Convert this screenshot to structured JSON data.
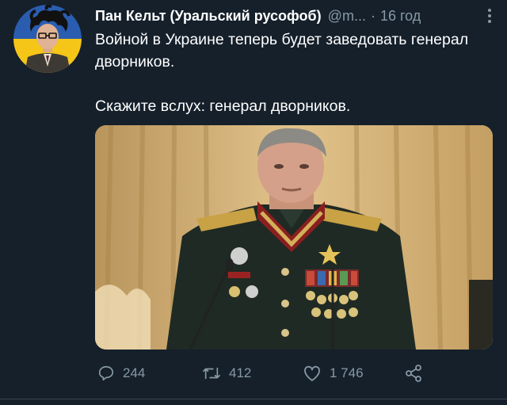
{
  "tweet": {
    "author_name": "Пан Кельт (Уральский русофоб)",
    "handle": "@m...",
    "separator": "·",
    "time": "16 год",
    "text_line1": "Войной в Украине теперь будет заведовать генерал дворников.",
    "text_line2": "Скажите вслух: генерал дворников.",
    "replies": "244",
    "retweets": "412",
    "likes": "1 746"
  },
  "icons": {
    "reply": "reply-icon",
    "retweet": "retweet-icon",
    "like": "like-icon",
    "share": "share-icon",
    "more": "more-icon"
  },
  "colors": {
    "background": "#15202b",
    "text": "#ffffff",
    "secondary_text": "#8899a6",
    "divider": "#38444d",
    "avatar_flag_blue": "#2a5db0",
    "avatar_flag_yellow": "#f5c518"
  }
}
